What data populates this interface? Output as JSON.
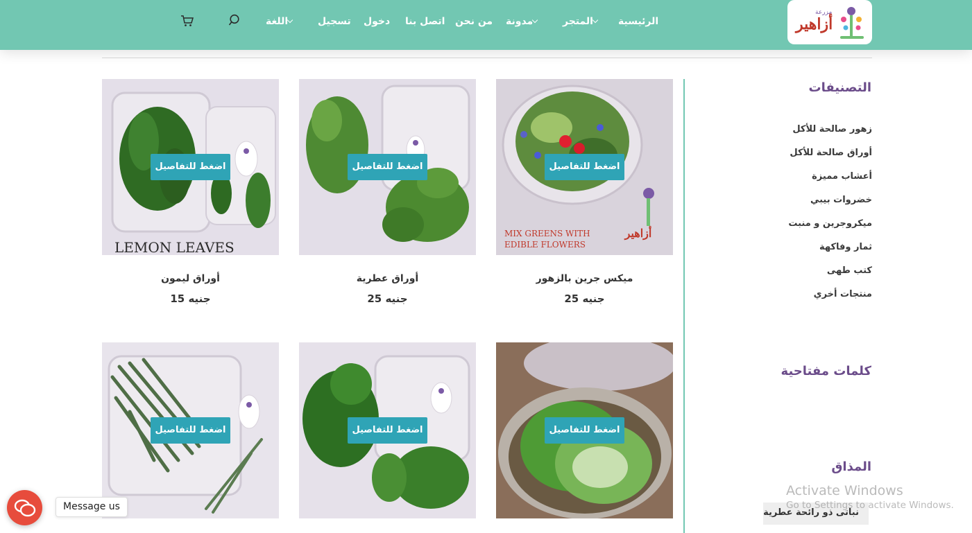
{
  "header": {
    "logo": {
      "name": "أزاهير",
      "sub": "مزرعة"
    },
    "nav": [
      {
        "label": "الرئيسية",
        "dropdown": false
      },
      {
        "label": "المتجر",
        "dropdown": true
      },
      {
        "label": "مدونة",
        "dropdown": true
      },
      {
        "label": "من نحن",
        "dropdown": false
      },
      {
        "label": "اتصل بنا",
        "dropdown": false
      },
      {
        "label": "دخول",
        "dropdown": false
      },
      {
        "label": "تسجيل",
        "dropdown": false
      },
      {
        "label": "اللغة",
        "dropdown": true
      }
    ],
    "icons": [
      "search-icon",
      "cart-icon"
    ]
  },
  "sidebar": {
    "categories_title": "التصنيفات",
    "categories": [
      "زهور صالحة للأكل",
      "أوراق صالحة للأكل",
      "أعشاب مميزة",
      "خضروات بيبي",
      "ميكروجرين و منبت",
      "ثمار وفاكهة",
      "كتب طهى",
      "منتجات أخري"
    ],
    "keywords_title": "كلمات مفتاحية",
    "taste_title": "المذاق",
    "taste_tag": "نباتى ذو رائحة عطرية"
  },
  "products": [
    {
      "name": "ميكس جرين بالزهور",
      "price": "جنيه 25",
      "button": "اضغط للتفاصيل",
      "image_caption": [
        "MIX GREENS WITH",
        "EDIBLE FLOWERS"
      ]
    },
    {
      "name": "أوراق عطرية",
      "price": "جنيه 25",
      "button": "اضغط للتفاصيل",
      "image_caption": []
    },
    {
      "name": "أوراق ليمون",
      "price": "جنيه 15",
      "button": "اضغط للتفاصيل",
      "image_caption": [
        "LEMON LEAVES"
      ]
    },
    {
      "name": "",
      "price": "",
      "button": "اضغط للتفاصيل",
      "image_caption": []
    },
    {
      "name": "",
      "price": "",
      "button": "اضغط للتفاصيل",
      "image_caption": []
    },
    {
      "name": "",
      "price": "",
      "button": "اضغط للتفاصيل",
      "image_caption": []
    }
  ],
  "chat": {
    "label": "Message us"
  },
  "watermark": {
    "line1": "Activate Windows",
    "line2": "Go to Settings to activate Windows."
  },
  "colors": {
    "header": "#72c7b2",
    "accent_button": "#2fa4b6",
    "sidebar_title": "#6b4c8a",
    "chat": "#e74c3c"
  }
}
